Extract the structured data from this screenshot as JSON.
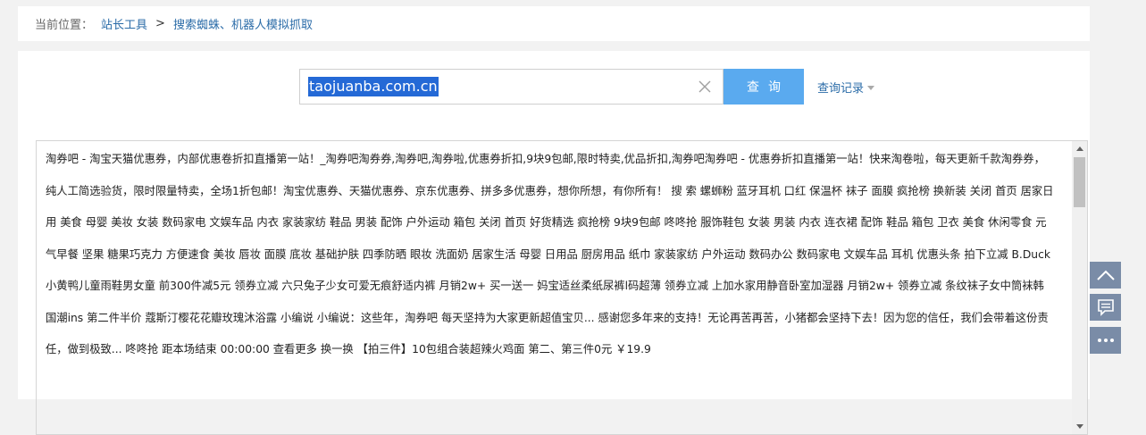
{
  "breadcrumb": {
    "prefix": "当前位置：",
    "items": [
      "站长工具",
      "搜索蜘蛛、机器人模拟抓取"
    ],
    "separator": ">"
  },
  "search": {
    "value": "taojuanba.com.cn",
    "button_label": "查询",
    "history_label": "查询记录"
  },
  "result": {
    "text": "淘券吧 - 淘宝天猫优惠券，内部优惠卷折扣直播第一站！_淘券吧淘券券,淘券吧,淘券啦,优惠券折扣,9块9包邮,限时特卖,优品折扣,淘券吧淘券吧 - 优惠券折扣直播第一站！快来淘卷啦，每天更新千款淘券券，纯人工简选验货，限时限量特卖，全场1折包邮！淘宝优惠券、天猫优惠券、京东优惠券、拼多多优惠券，想你所想，有你所有！ 搜 索 螺蛳粉 蓝牙耳机 口红 保温杯 袜子 面膜 疯抢榜 换新装 关闭 首页 居家日用 美食 母婴 美妆 女装 数码家电 文娱车品 内衣 家装家纺 鞋品 男装 配饰 户外运动 箱包 关闭 首页 好货精选 疯抢榜 9块9包邮 咚咚抢 服饰鞋包 女装 男装 内衣 连衣裙 配饰 鞋品 箱包 卫衣 美食 休闲零食 元气早餐 坚果 糖果巧克力 方便速食 美妆 唇妆 面膜 底妆 基础护肤 四季防晒 眼妆 洗面奶 居家生活 母婴 日用品 厨房用品 纸巾 家装家纺 户外运动 数码办公 数码家电 文娱车品 耳机 优惠头条 拍下立减 B.Duck小黄鸭儿童雨鞋男女童 前300件减5元 领券立减 六只兔子少女可爱无痕舒适内裤 月销2w+ 买一送一 妈宝适丝柔纸尿裤l码超薄 领券立减 上加水家用静音卧室加湿器 月销2w+ 领券立减 条纹袜子女中筒袜韩国潮ins 第二件半价 蔻斯汀樱花花瓣玫瑰沐浴露 小编说 小编说：这些年，淘券吧 每天坚持为大家更新超值宝贝... 感谢您多年来的支持！无论再苦再苦，小猪都会坚持下去！因为您的信任，我们会带着这份责任，做到极致... 咚咚抢 距本场结束 00:00:00 查看更多 换一换 【拍三件】10包组合装超辣火鸡面 第二、第三件0元 ￥19.9"
  },
  "float_buttons": [
    "back-to-top",
    "feedback",
    "more"
  ],
  "colors": {
    "page_bg": "#f2f2f2",
    "link": "#2b6ca8",
    "search_button": "#5aaaef",
    "float_button": "#7a8ca7",
    "selection": "#2469d6"
  }
}
